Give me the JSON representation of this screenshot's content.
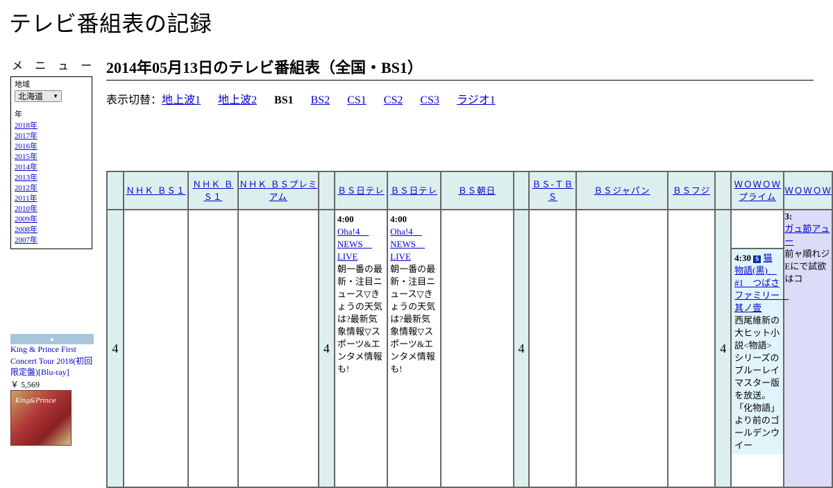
{
  "site": {
    "title": "テレビ番組表の記録"
  },
  "sidebar": {
    "menu_title": "メ ニ ュ ー",
    "region_label": "地域",
    "region_value": "北海道",
    "year_label": "年",
    "years": [
      "2018年",
      "2017年",
      "2016年",
      "2015年",
      "2014年",
      "2013年",
      "2012年",
      "2011年",
      "2010年",
      "2009年",
      "2008年",
      "2007年"
    ]
  },
  "ad": {
    "title": "King & Prince First Concert Tour 2018(初回限定盤)[Blu-ray]",
    "price": "￥ 5,569",
    "image_logo": "King&Prince"
  },
  "main": {
    "heading": "2014年05月13日のテレビ番組表（全国・BS1）",
    "switch_label": "表示切替：",
    "switch_links": [
      "地上波1",
      "地上波2",
      "BS1",
      "BS2",
      "CS1",
      "CS2",
      "CS3",
      "ラジオ1"
    ],
    "current": "BS1"
  },
  "schedule": {
    "hour": "4",
    "channels": [
      "ＮＨＫ ＢＳ１",
      "ＮＨＫ ＢＳ１",
      "ＮＨＫ ＢＳプレミアム",
      "ＢＳ日テレ",
      "ＢＳ日テレ",
      "ＢＳ朝日",
      "ＢＳ-ＴＢＳ",
      "ＢＳジャパン",
      "ＢＳフジ",
      "ＷＯＷＯＷプライム",
      "ＷＯＷＯＷ"
    ],
    "bs_nittele_1": {
      "time": "4:00",
      "title": "Oha!4　NEWS　LIVE",
      "desc": "朝一番の最新・注目ニュース▽きょうの天気は?最新気象情報▽スポーツ&エンタメ情報も!"
    },
    "bs_nittele_2": {
      "time": "4:00",
      "title": "Oha!4　NEWS　LIVE",
      "desc": "朝一番の最新・注目ニュース▽きょうの天気は?最新気象情報▽スポーツ&エンタメ情報も!"
    },
    "wowow_prime": {
      "time": "4:30",
      "icon": "S",
      "title": "猫物語(黒)　#1　つばさファミリー　其ノ壹",
      "desc": "西尾維新の大ヒット小説<物語>シリーズのブルーレイマスター版を放送。「化物語」より前のゴールデンウイー"
    },
    "wowow_edge": {
      "time": "3:",
      "title": "ガュ節アュー",
      "desc": "前ャ順れジEにで試欲はコ"
    }
  }
}
